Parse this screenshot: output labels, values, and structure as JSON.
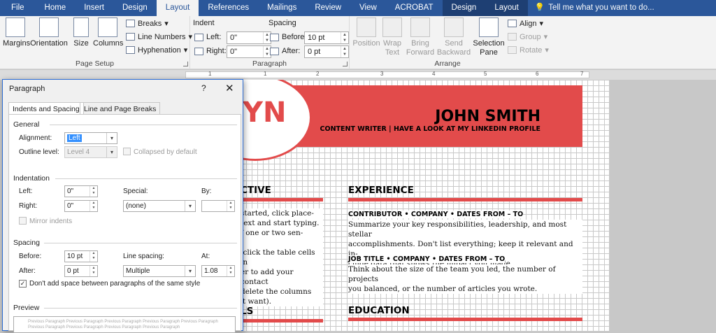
{
  "tabs": [
    "File",
    "Home",
    "Insert",
    "Design",
    "Layout",
    "References",
    "Mailings",
    "Review",
    "View",
    "ACROBAT",
    "Design",
    "Layout"
  ],
  "active_tab": "Layout",
  "tell_me": "Tell me what you want to do...",
  "page_setup": {
    "margins": "Margins",
    "orientation": "Orientation",
    "size": "Size",
    "columns": "Columns",
    "breaks": "Breaks",
    "line_numbers": "Line Numbers",
    "hyphenation": "Hyphenation",
    "group": "Page Setup"
  },
  "paragraph_group": {
    "indent": "Indent",
    "left_label": "Left:",
    "left_val": "0\"",
    "right_label": "Right:",
    "right_val": "0\"",
    "spacing": "Spacing",
    "before_label": "Before:",
    "before_val": "10 pt",
    "after_label": "After:",
    "after_val": "0 pt",
    "group": "Paragraph"
  },
  "arrange": {
    "position": "Position",
    "wrap1": "Wrap",
    "wrap2": "Text",
    "bring1": "Bring",
    "bring2": "Forward",
    "send1": "Send",
    "send2": "Backward",
    "sel1": "Selection",
    "sel2": "Pane",
    "align": "Align",
    "groupbtn": "Group",
    "rotate": "Rotate",
    "group": "Arrange"
  },
  "ruler": [
    "1",
    "1",
    "2",
    "3",
    "4",
    "5",
    "6",
    "7"
  ],
  "doc": {
    "initials": "YN",
    "name": "JOHN SMITH",
    "subtitle": "CONTENT WRITER | HAVE A LOOK AT MY LINKEDIN PROFILE",
    "objective_head": "CTIVE",
    "objective_text": [
      "started, click place-",
      "text and start typing.",
      "f one or two sen-",
      "",
      "-click the table cells in",
      "er to add your contact",
      "delete the columns",
      "'t want)."
    ],
    "experience_head": "EXPERIENCE",
    "job1": "CONTRIBUTOR • COMPANY • DATES FROM – TO",
    "job1_text": [
      "Summarize your key responsibilities, leadership, and most stellar",
      "accomplishments.  Don't list everything; keep it relevant and in-",
      "clude data that shows the impact you made."
    ],
    "job2": "JOB TITLE • COMPANY • DATES FROM – TO",
    "job2_text": [
      "Think about the size of the team you led, the number of projects",
      "you balanced, or the number of articles you wrote."
    ],
    "skills_head": "LS",
    "education_head": "EDUCATION"
  },
  "dialog": {
    "title": "Paragraph",
    "help": "?",
    "close": "✕",
    "tab1": "Indents and Spacing",
    "tab2": "Line and Page Breaks",
    "general": "General",
    "alignment_label": "Alignment:",
    "alignment_val": "Left",
    "outline_label": "Outline level:",
    "outline_val": "Level 4",
    "collapsed": "Collapsed by default",
    "indentation": "Indentation",
    "left_label": "Left:",
    "left_val": "0\"",
    "right_label": "Right:",
    "right_val": "0\"",
    "special_label": "Special:",
    "special_val": "(none)",
    "by_label": "By:",
    "mirror": "Mirror indents",
    "spacing": "Spacing",
    "before_label": "Before:",
    "before_val": "10 pt",
    "after_label": "After:",
    "after_val": "0 pt",
    "line_spacing_label": "Line spacing:",
    "line_spacing_val": "Multiple",
    "at_label": "At:",
    "at_val": "1.08",
    "dont_add": "Don't add space between paragraphs of the same style",
    "preview": "Preview",
    "preview_text": "Previous Paragraph Previous Paragraph Previous Paragraph Previous Paragraph Previous Paragraph Previous Paragraph Previous Paragraph Previous Paragraph Previous Paragraph"
  }
}
